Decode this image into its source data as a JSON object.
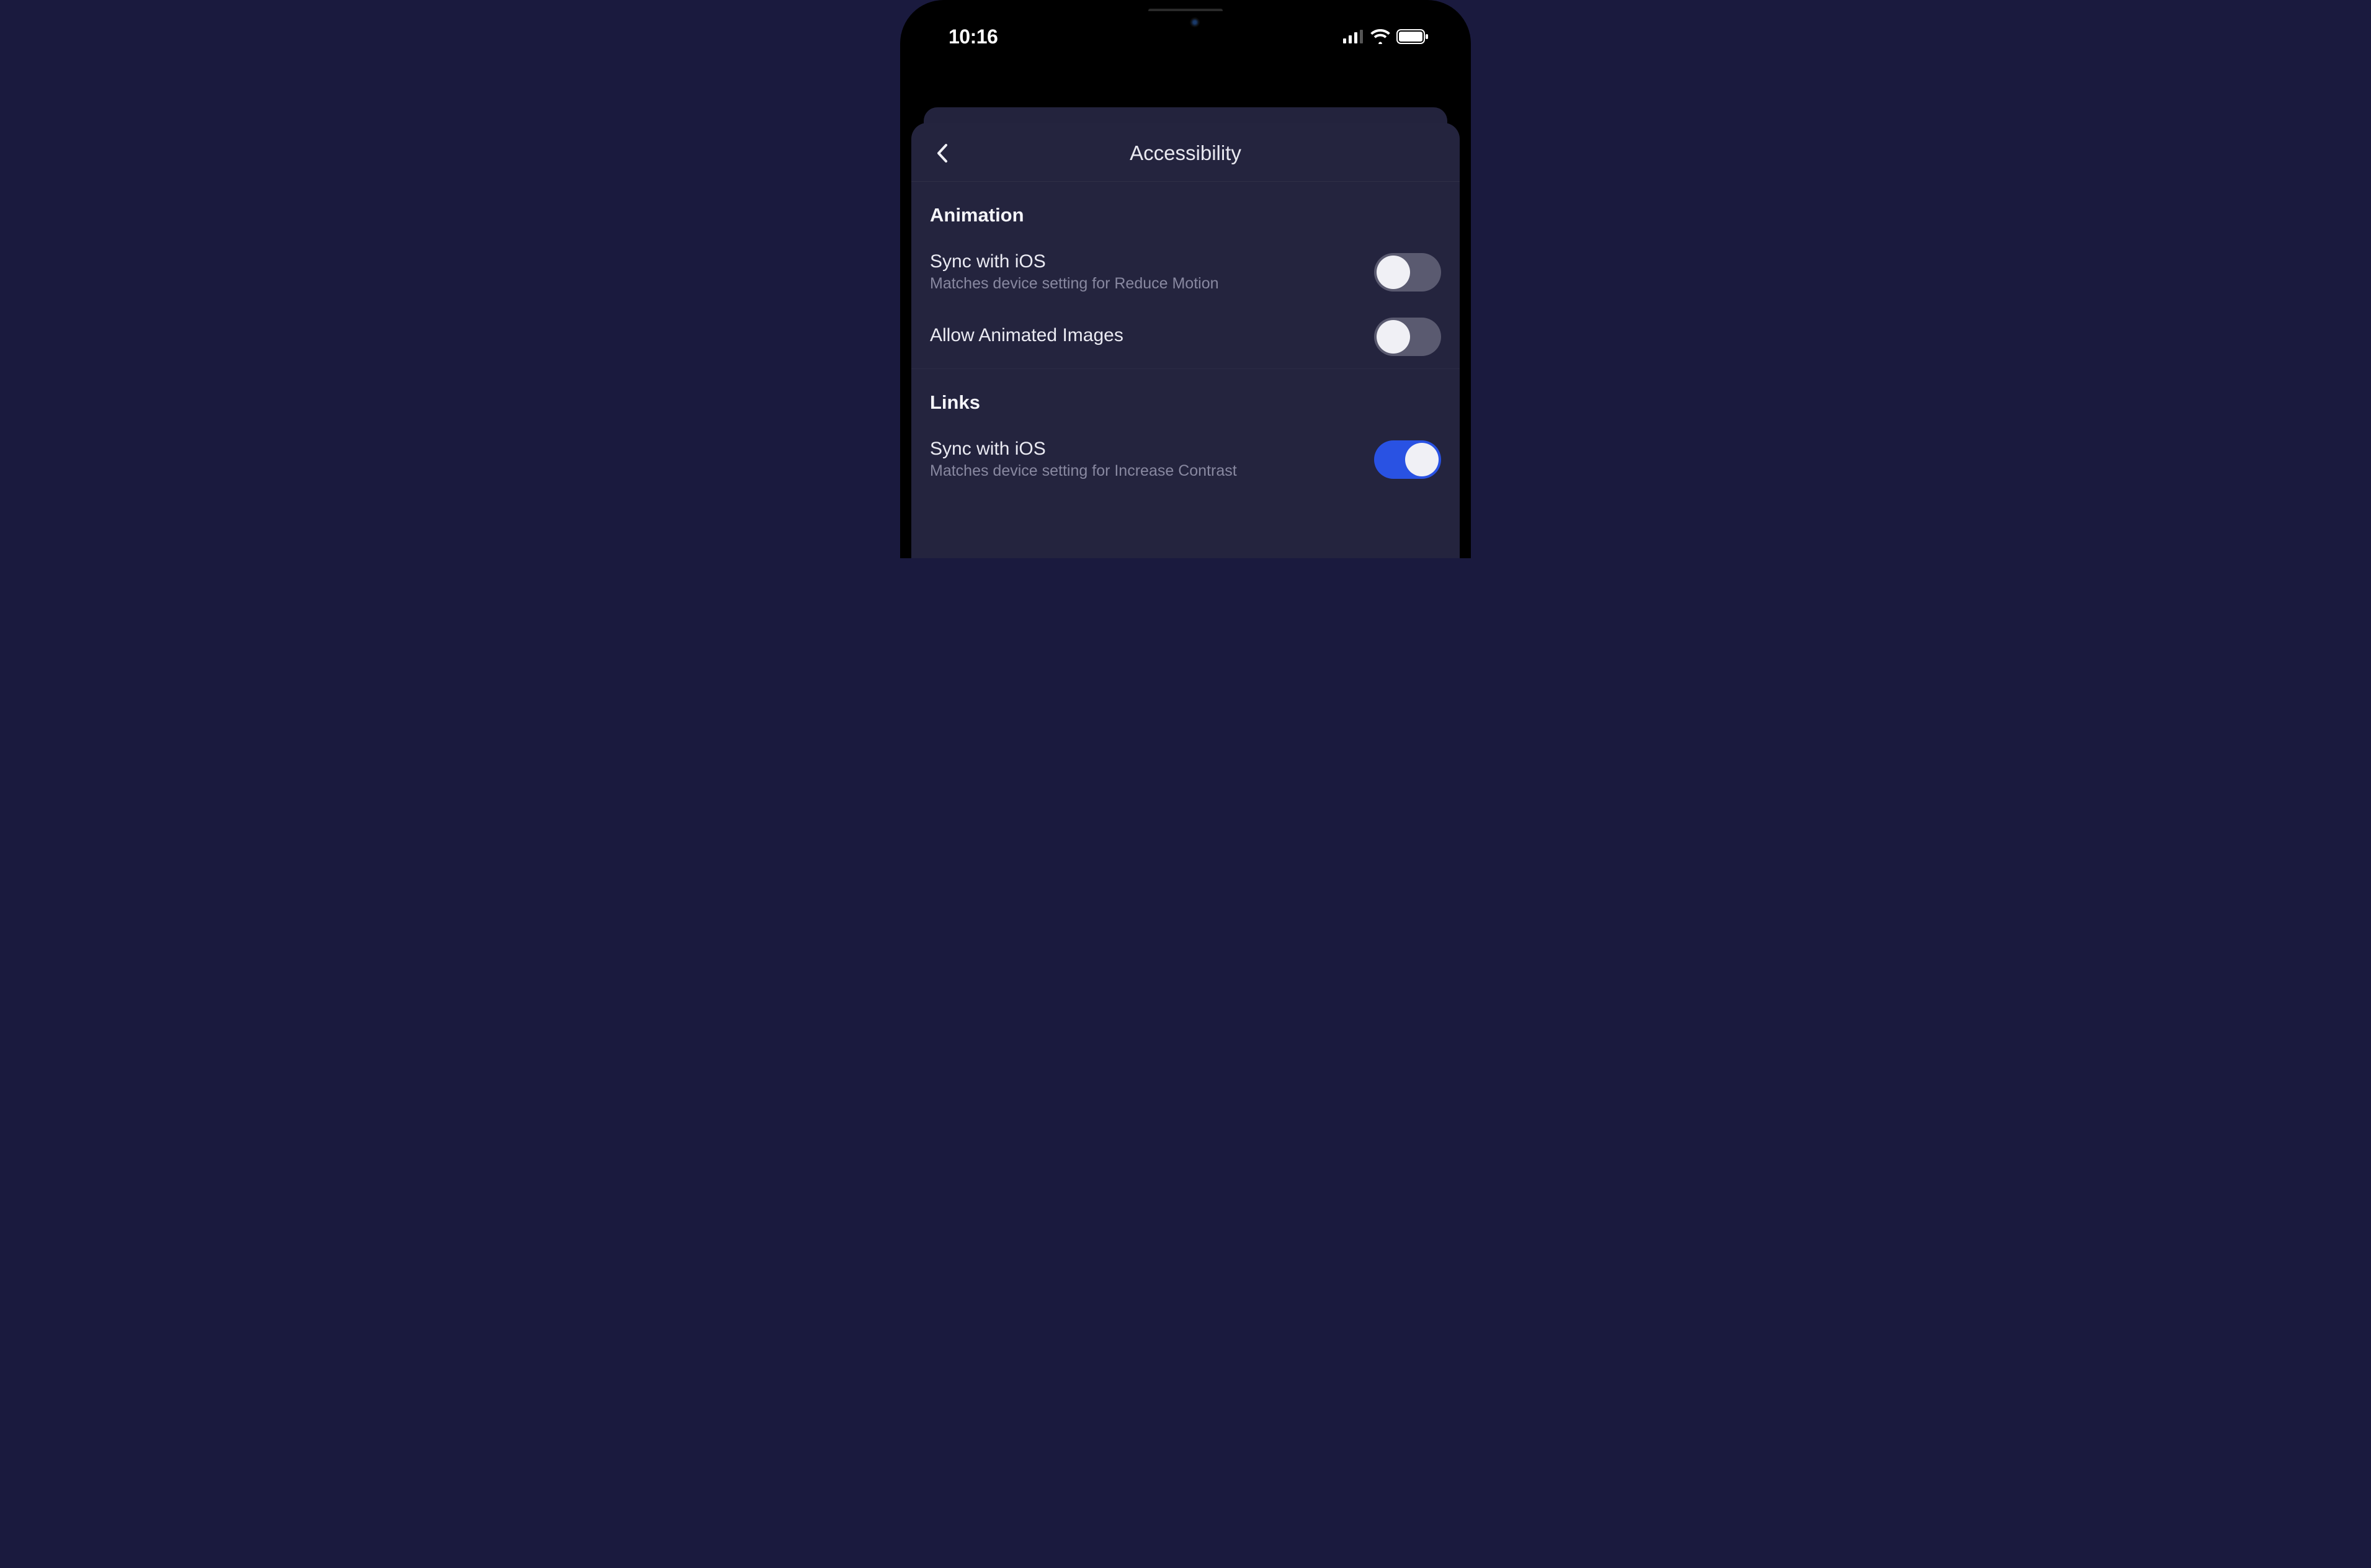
{
  "status_bar": {
    "time": "10:16"
  },
  "nav": {
    "title": "Accessibility"
  },
  "sections": [
    {
      "header": "Animation",
      "rows": [
        {
          "title": "Sync with iOS",
          "subtitle": "Matches device setting for Reduce Motion",
          "toggle": "off"
        },
        {
          "title": "Allow Animated Images",
          "subtitle": null,
          "toggle": "off"
        }
      ]
    },
    {
      "header": "Links",
      "rows": [
        {
          "title": "Sync with iOS",
          "subtitle": "Matches device setting for Increase Contrast",
          "toggle": "on"
        }
      ]
    }
  ],
  "colors": {
    "background": "#1a1a3e",
    "sheet": "#24243e",
    "toggle_on": "#2952e3",
    "toggle_off": "#5a5a70",
    "text_primary": "#eaeaf2",
    "text_secondary": "#8888a0"
  }
}
